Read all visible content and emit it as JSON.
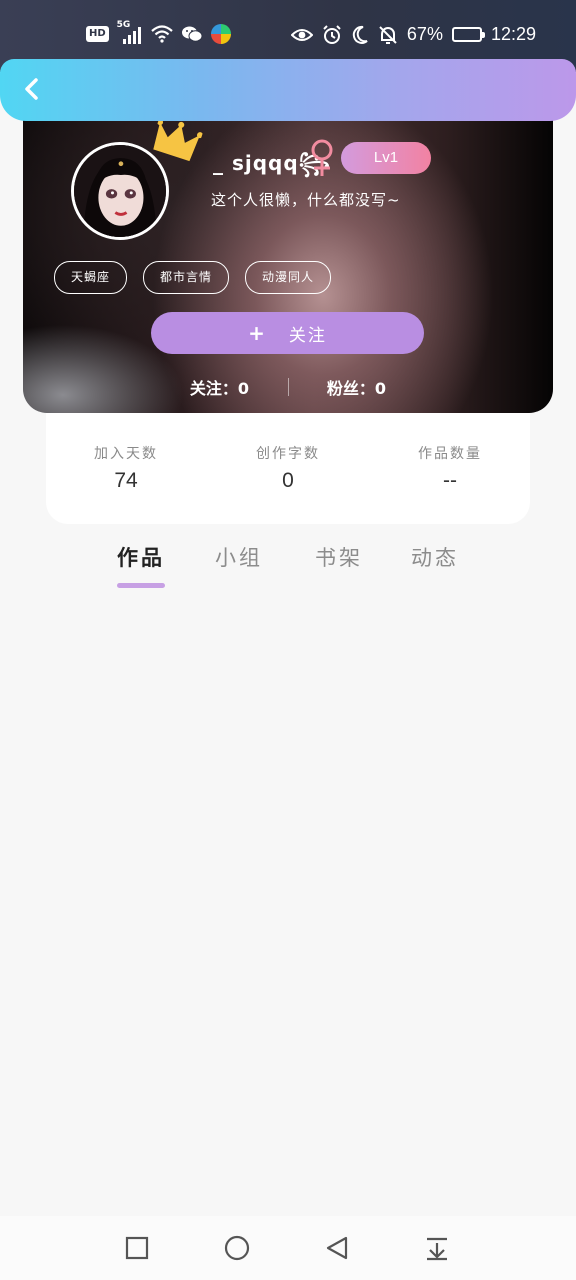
{
  "status_bar": {
    "hd_label": "HD",
    "network_label": "5G",
    "battery_percent": "67%",
    "battery_level": 0.67,
    "time": "12:29",
    "icons": [
      "hd-icon",
      "signal-icon",
      "wifi-icon",
      "wechat-icon",
      "app-icon",
      "eye-icon",
      "alarm-icon",
      "moon-icon",
      "bell-off-icon",
      "battery-icon"
    ]
  },
  "header": {
    "back_icon": "chevron-left-icon"
  },
  "profile": {
    "username": "_ sjqqq꧂",
    "gender_icon": "female-icon",
    "level": "Lv1",
    "bio": "这个人很懒，什么都没写~",
    "tags": [
      "天蝎座",
      "都市言情",
      "动漫同人"
    ],
    "follow_button": {
      "plus": "+",
      "label": "关注"
    },
    "following": "关注：0",
    "fans": "粉丝：0"
  },
  "stats": [
    {
      "label": "加入天数",
      "value": "74"
    },
    {
      "label": "创作字数",
      "value": "0"
    },
    {
      "label": "作品数量",
      "value": "--"
    }
  ],
  "tabs": [
    {
      "label": "作品",
      "active": true
    },
    {
      "label": "小组",
      "active": false
    },
    {
      "label": "书架",
      "active": false
    },
    {
      "label": "动态",
      "active": false
    }
  ],
  "nav_bar": {
    "buttons": [
      "recent-apps-icon",
      "home-icon",
      "back-icon",
      "notification-pull-icon"
    ]
  },
  "colors": {
    "header_gradient_start": "#51d6f3",
    "header_gradient_end": "#bc98ea",
    "follow_button": "#b98ee2",
    "level_badge_start": "#d39bdd",
    "level_badge_end": "#f282a2",
    "tab_indicator": "#c7a0e4",
    "gender_icon": "#f28ca0"
  }
}
